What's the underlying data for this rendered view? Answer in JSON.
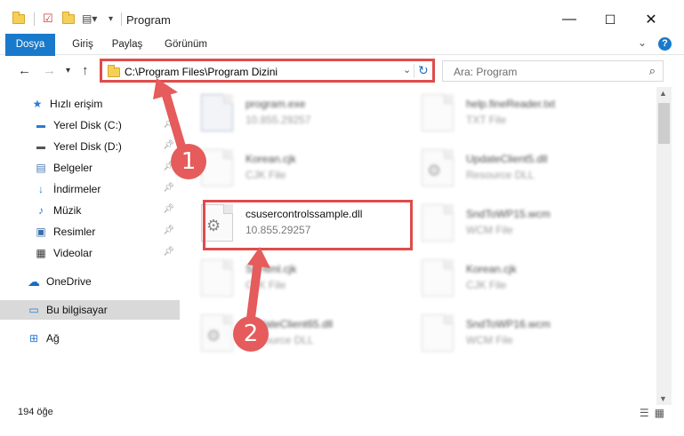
{
  "window": {
    "title": "Program",
    "minimize": "—",
    "maximize": "☐",
    "close": "✕"
  },
  "ribbon": {
    "file_tab": "Dosya",
    "tabs": [
      "Giriş",
      "Paylaş",
      "Görünüm"
    ],
    "help": "?"
  },
  "address": {
    "path": "C:\\Program Files\\Program Dizini",
    "search_placeholder": "Ara: Program"
  },
  "sidebar": {
    "items": [
      {
        "label": "Hızlı erişim",
        "icon": "star-icon"
      },
      {
        "label": "Yerel Disk (C:)",
        "icon": "drive-icon",
        "pinned": true
      },
      {
        "label": "Yerel Disk (D:)",
        "icon": "drive-icon",
        "pinned": true
      },
      {
        "label": "Belgeler",
        "icon": "documents-icon",
        "pinned": true
      },
      {
        "label": "İndirmeler",
        "icon": "download-icon",
        "pinned": true
      },
      {
        "label": "Müzik",
        "icon": "music-icon",
        "pinned": true
      },
      {
        "label": "Resimler",
        "icon": "pictures-icon",
        "pinned": true
      },
      {
        "label": "Videolar",
        "icon": "video-icon",
        "pinned": true
      },
      {
        "label": "OneDrive",
        "icon": "cloud-icon"
      },
      {
        "label": "Bu bilgisayar",
        "icon": "computer-icon",
        "selected": true
      },
      {
        "label": "Ağ",
        "icon": "network-icon"
      }
    ]
  },
  "files": [
    {
      "name": "program.exe",
      "desc": "10.855.29257",
      "icon": "exe-icon"
    },
    {
      "name": "help.fineReader.txt",
      "desc": "TXT File",
      "icon": "text-file-icon"
    },
    {
      "name": "Korean.cjk",
      "desc": "CJK File",
      "icon": "blank-file-icon"
    },
    {
      "name": "UpdateClient5.dll",
      "desc": "Resource DLL",
      "icon": "dll-icon"
    },
    {
      "name": "csusercontrolssample.dll",
      "desc": "10.855.29257",
      "icon": "dll-icon"
    },
    {
      "name": "SndToWP15.wcm",
      "desc": "WCM File",
      "icon": "blank-file-icon"
    },
    {
      "name": "ShHtml.cjk",
      "desc": "CJK File",
      "icon": "blank-file-icon"
    },
    {
      "name": "Korean.cjk",
      "desc": "CJK File",
      "icon": "blank-file-icon"
    },
    {
      "name": "UpdateClient65.dll",
      "desc": "Resource DLL",
      "icon": "dll-icon"
    },
    {
      "name": "SndToWP16.wcm",
      "desc": "WCM File",
      "icon": "blank-file-icon"
    }
  ],
  "status": {
    "count": "194 öğe"
  },
  "callouts": [
    "1",
    "2"
  ],
  "colors": {
    "accent": "#1979ca",
    "highlight": "#e04b4b",
    "callout": "#e65b5b"
  }
}
